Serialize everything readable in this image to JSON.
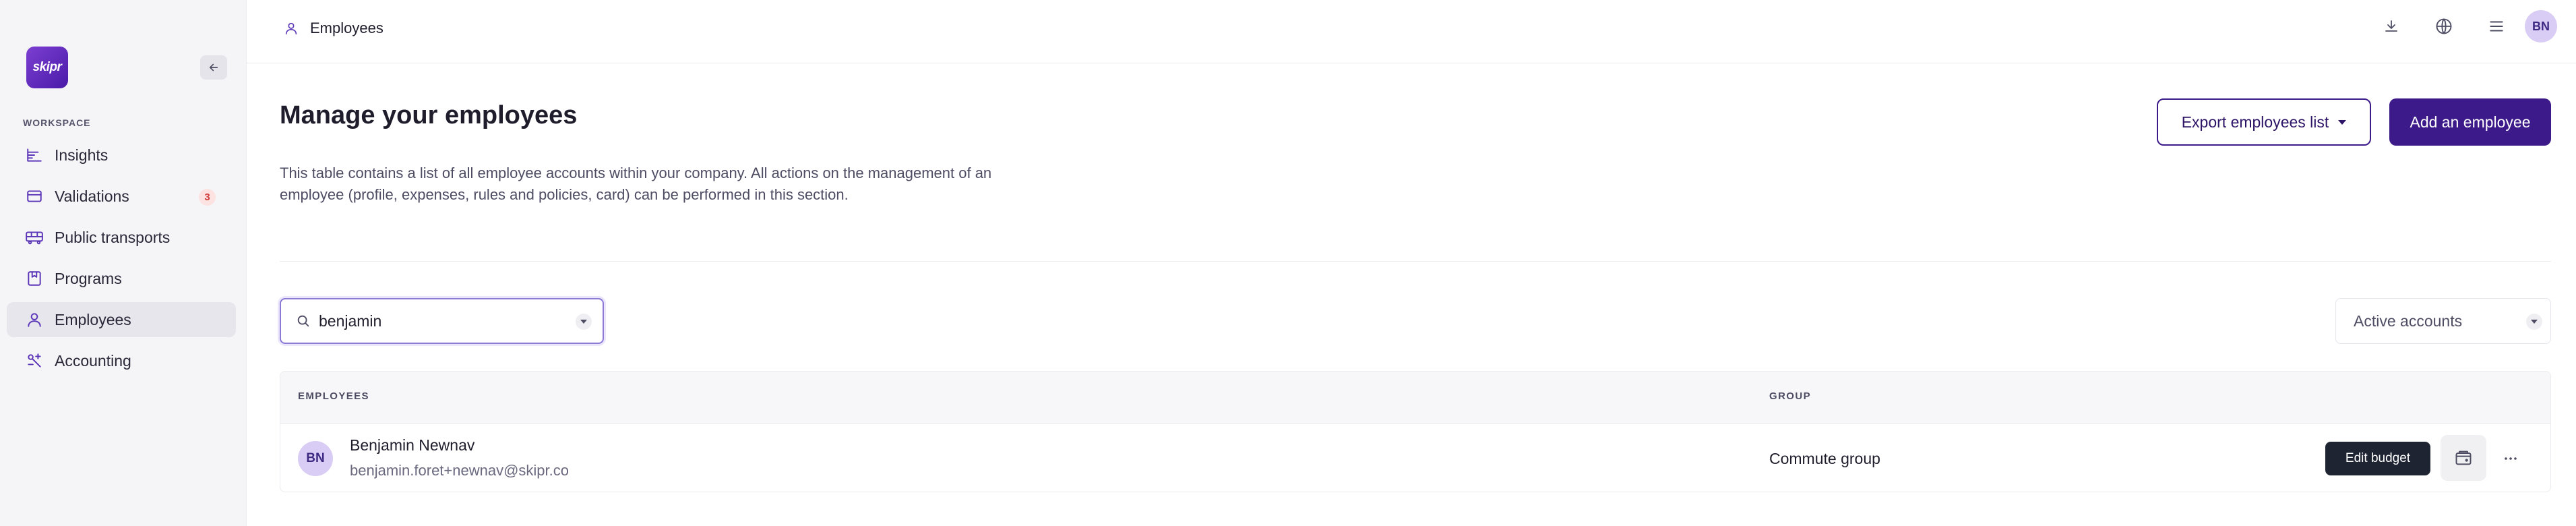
{
  "app": {
    "logo_text": "skipr",
    "brand_color": "#3d1a8a"
  },
  "sidebar": {
    "section_label": "WORKSPACE",
    "items": [
      {
        "label": "Insights",
        "icon": "chart-icon"
      },
      {
        "label": "Validations",
        "icon": "card-icon",
        "badge": "3"
      },
      {
        "label": "Public transports",
        "icon": "bus-icon"
      },
      {
        "label": "Programs",
        "icon": "program-icon"
      },
      {
        "label": "Employees",
        "icon": "user-icon",
        "active": true
      },
      {
        "label": "Accounting",
        "icon": "accounting-icon"
      }
    ]
  },
  "header": {
    "breadcrumb": "Employees",
    "user_initials": "BN",
    "icons": [
      "download-icon",
      "globe-icon",
      "menu-icon"
    ]
  },
  "main": {
    "title": "Manage your employees",
    "description": "This table contains a list of all employee accounts within your company. All actions on the management of an employee (profile, expenses, rules and policies, card) can be performed in this section.",
    "export_label": "Export employees list",
    "add_label": "Add an employee",
    "search": {
      "value": "benjamin"
    },
    "filter": {
      "selected": "Active accounts"
    },
    "table": {
      "columns": [
        "EMPLOYEES",
        "GROUP"
      ],
      "rows": [
        {
          "initials": "BN",
          "name": "Benjamin Newnav",
          "email": "benjamin.foret+newnav@skipr.co",
          "group": "Commute group",
          "tooltip": "Edit budget"
        }
      ]
    }
  }
}
